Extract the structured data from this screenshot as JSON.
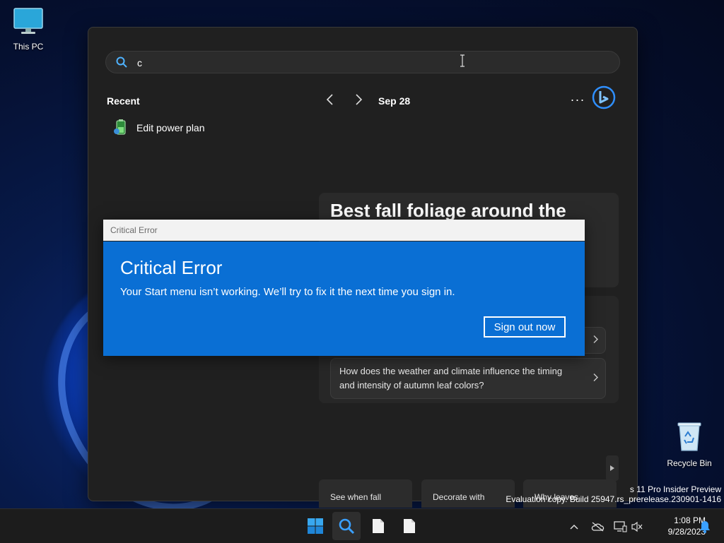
{
  "desktop": {
    "icons": [
      {
        "label": "This PC"
      },
      {
        "label": "Recycle Bin"
      }
    ],
    "watermark": {
      "line1": "s 11 Pro Insider Preview",
      "line2": "Evaluation copy. Build 25947.rs_prerelease.230901-1416"
    }
  },
  "search_panel": {
    "query": "c",
    "recent_label": "Recent",
    "date_label": "Sep 28",
    "more_label": "···",
    "recent_items": [
      {
        "label": "Edit power plan"
      }
    ],
    "hero_title": "Best fall foliage around the",
    "chat_prompts": [
      {
        "label": ""
      },
      {
        "label": "How does the weather and climate influence the timing and intensity of autumn leaf colors?"
      }
    ],
    "cards": [
      {
        "label": "See when fall"
      },
      {
        "label": "Decorate with"
      },
      {
        "label": "Why leaves"
      }
    ]
  },
  "dialog": {
    "window_title": "Critical Error",
    "heading": "Critical Error",
    "message": "Your Start menu isn’t working. We’ll try to fix it the next time you sign in.",
    "button_label": "Sign out now",
    "bg_color": "#0a6fd4"
  },
  "taskbar": {
    "time": "1:08 PM",
    "date": "9/28/2023",
    "apps": [
      "start-icon",
      "search-icon",
      "file-icon",
      "file-icon"
    ],
    "tray": [
      "chevron-up-icon",
      "cloud-off-icon",
      "network-icon",
      "volume-muted-icon",
      "notification-bell-icon"
    ]
  }
}
